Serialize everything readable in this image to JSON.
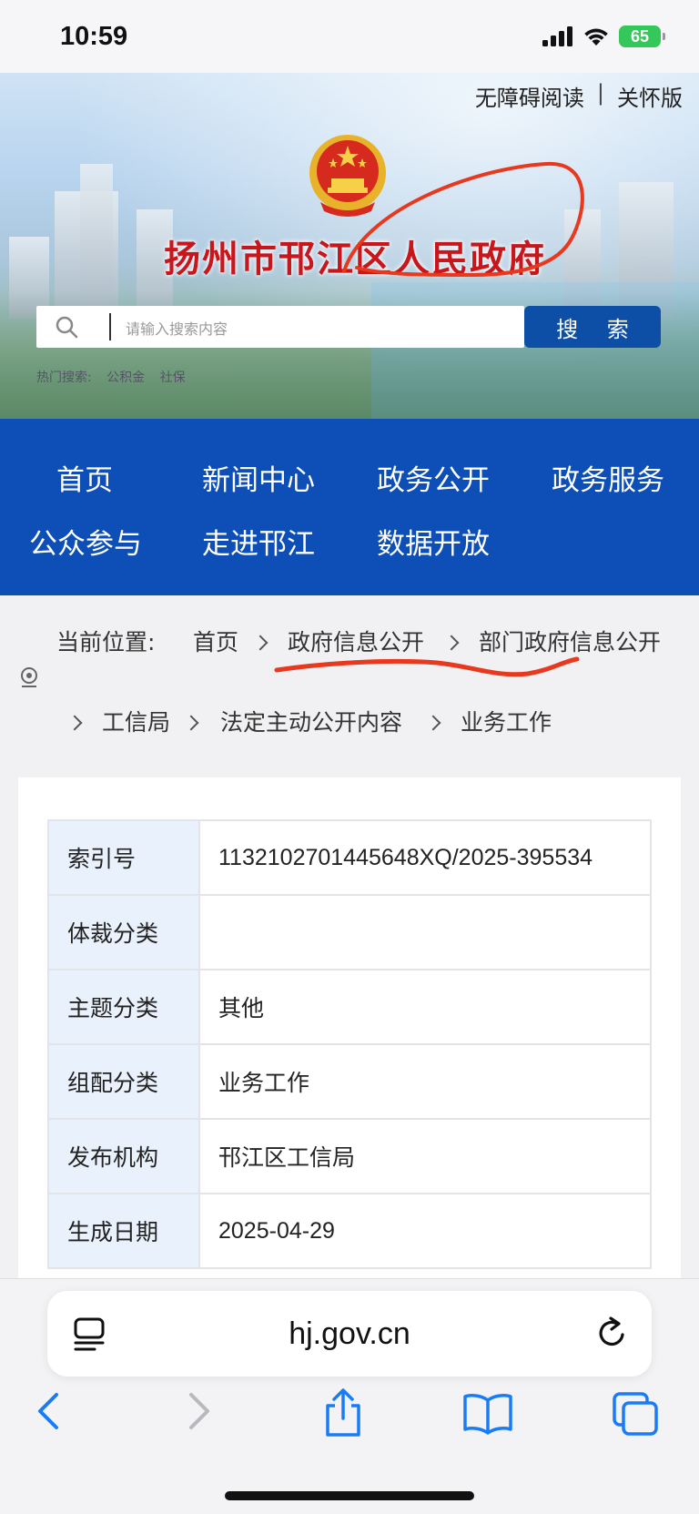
{
  "status": {
    "time": "10:59",
    "battery": "65"
  },
  "banner": {
    "top_links": [
      "无障碍阅读",
      "关怀版"
    ],
    "top_sep": "|",
    "site_title": "扬州市邗江区人民政府",
    "search_placeholder": "请输入搜索内容",
    "search_button": "搜 索",
    "hot_label": "热门搜索:",
    "hot_terms": [
      "公积金",
      "社保"
    ]
  },
  "nav": {
    "items": [
      "首页",
      "新闻中心",
      "政务公开",
      "政务服务",
      "公众参与",
      "走进邗江",
      "数据开放"
    ]
  },
  "breadcrumb": {
    "label": "当前位置:",
    "items": [
      "首页",
      "政府信息公开",
      "部门政府信息公开",
      "工信局",
      "法定主动公开内容",
      "业务工作"
    ]
  },
  "info_table": [
    {
      "label": "索引号",
      "value": "113210270144564​8XQ/2025-395534"
    },
    {
      "label": "体裁分类",
      "value": ""
    },
    {
      "label": "主题分类",
      "value": "其他"
    },
    {
      "label": "组配分类",
      "value": "业务工作"
    },
    {
      "label": "发布机构",
      "value": "邗江区工信局"
    },
    {
      "label": "生成日期",
      "value": "2025-04-29"
    }
  ],
  "browser": {
    "url": "hj.gov.cn"
  },
  "colors": {
    "nav_blue": "#0d4fb6",
    "search_blue": "#0d4ea7",
    "title_red": "#c8161d",
    "annotation_red": "#e8381e"
  }
}
